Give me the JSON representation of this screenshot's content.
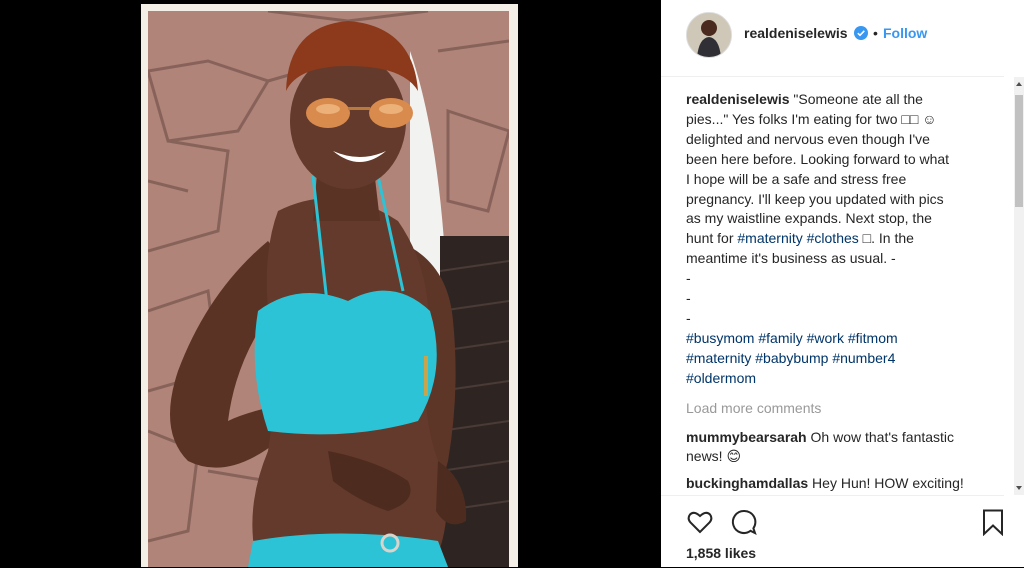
{
  "post": {
    "username": "realdeniselewis",
    "dot": "•",
    "follow_label": "Follow",
    "likes": "1,858 likes"
  },
  "caption": {
    "author": "realdeniselewis",
    "lines": [
      "\"Someone ate all the",
      "pies...\" Yes folks I'm eating for two □□ ☺",
      "delighted and nervous even though I've",
      "been here before. Looking forward to what",
      "I hope will be a safe and stress free",
      "pregnancy. I'll keep you updated with pics",
      "as my waistline expands. Next stop, the"
    ],
    "hunt_prefix": "hunt for ",
    "tag_maternity": "#maternity",
    "tag_clothes": "#clothes",
    "hunt_suffix": " □. In the",
    "line_meantime": "meantime it's business as usual. -",
    "dash": "-",
    "hashtags_row1": [
      "#busymom",
      "#family",
      "#work",
      "#fitmom"
    ],
    "hashtags_row2": [
      "#maternity",
      "#babybump",
      "#number4"
    ],
    "hashtags_row3": [
      "#oldermom"
    ]
  },
  "load_more": "Load more comments",
  "comment1": {
    "user": "mummybearsarah",
    "text": "Oh wow that's fantastic",
    "text2": "news! 😊"
  },
  "comment2": {
    "user": "buckinghamdallas",
    "text": "Hey Hun! HOW exciting!"
  },
  "icons": {
    "verified": "verified-badge-icon",
    "like": "heart-icon",
    "comment": "comment-bubble-icon",
    "save": "bookmark-icon"
  },
  "colors": {
    "link": "#3897f0",
    "hashtag": "#003569",
    "bikini": "#2cc3d6"
  }
}
